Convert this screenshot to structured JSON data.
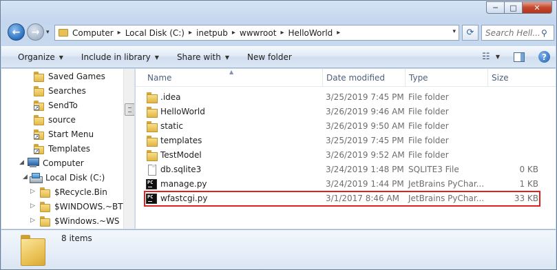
{
  "window": {
    "min_label": "─",
    "max_label": "□",
    "close_label": "✕"
  },
  "nav": {
    "back_glyph": "←",
    "forward_glyph": "→",
    "recent_glyph": "▾"
  },
  "address": {
    "breadcrumbs": [
      "Computer",
      "Local Disk (C:)",
      "inetpub",
      "wwwroot",
      "HelloWorld"
    ],
    "separator": "▸",
    "dropdown_glyph": "▾",
    "refresh_glyph": "⟳"
  },
  "search": {
    "placeholder": "Search Hell...",
    "icon_glyph": "⚲"
  },
  "toolbar": {
    "organize": "Organize",
    "include_in_library": "Include in library",
    "share_with": "Share with",
    "new_folder": "New folder",
    "dropdown_glyph": "▼",
    "views_glyph": "☷",
    "help_glyph": "?"
  },
  "navigation_pane": {
    "items": [
      {
        "label": "Saved Games",
        "icon": "folder-icon"
      },
      {
        "label": "Searches",
        "icon": "folder-icon"
      },
      {
        "label": "SendTo",
        "icon": "shortcut-folder-icon"
      },
      {
        "label": "source",
        "icon": "folder-icon"
      },
      {
        "label": "Start Menu",
        "icon": "shortcut-folder-icon"
      },
      {
        "label": "Templates",
        "icon": "shortcut-folder-icon"
      },
      {
        "label": "Computer",
        "icon": "computer-icon"
      },
      {
        "label": "Local Disk (C:)",
        "icon": "disk-icon"
      },
      {
        "label": "$Recycle.Bin",
        "icon": "folder-icon"
      },
      {
        "label": "$WINDOWS.~BT",
        "icon": "folder-icon"
      },
      {
        "label": "$Windows.~WS",
        "icon": "folder-icon"
      }
    ],
    "collapse_glyph": "◢",
    "expand_glyph": "▷"
  },
  "columns": {
    "name": "Name",
    "date_modified": "Date modified",
    "type": "Type",
    "size": "Size",
    "sort_glyph": "▲"
  },
  "files": [
    {
      "name": ".idea",
      "date": "3/25/2019 7:45 PM",
      "type": "File folder",
      "size": "",
      "icon": "folder-icon"
    },
    {
      "name": "HelloWorld",
      "date": "3/26/2019 9:46 AM",
      "type": "File folder",
      "size": "",
      "icon": "folder-icon"
    },
    {
      "name": "static",
      "date": "3/26/2019 9:50 AM",
      "type": "File folder",
      "size": "",
      "icon": "folder-icon"
    },
    {
      "name": "templates",
      "date": "3/25/2019 7:45 PM",
      "type": "File folder",
      "size": "",
      "icon": "folder-icon"
    },
    {
      "name": "TestModel",
      "date": "3/26/2019 9:52 AM",
      "type": "File folder",
      "size": "",
      "icon": "folder-icon"
    },
    {
      "name": "db.sqlite3",
      "date": "3/24/2019 1:48 PM",
      "type": "SQLITE3 File",
      "size": "0 KB",
      "icon": "document-icon"
    },
    {
      "name": "manage.py",
      "date": "3/24/2019 1:44 PM",
      "type": "JetBrains PyChar...",
      "size": "1 KB",
      "icon": "pycharm-icon"
    },
    {
      "name": "wfastcgi.py",
      "date": "3/1/2017 8:46 AM",
      "type": "JetBrains PyChar...",
      "size": "33 KB",
      "icon": "pycharm-icon"
    }
  ],
  "pycharm_icon_text": "PC",
  "details": {
    "item_count": "8 items"
  },
  "colors": {
    "highlight_border": "#e02020",
    "folder": "#e8c053"
  }
}
